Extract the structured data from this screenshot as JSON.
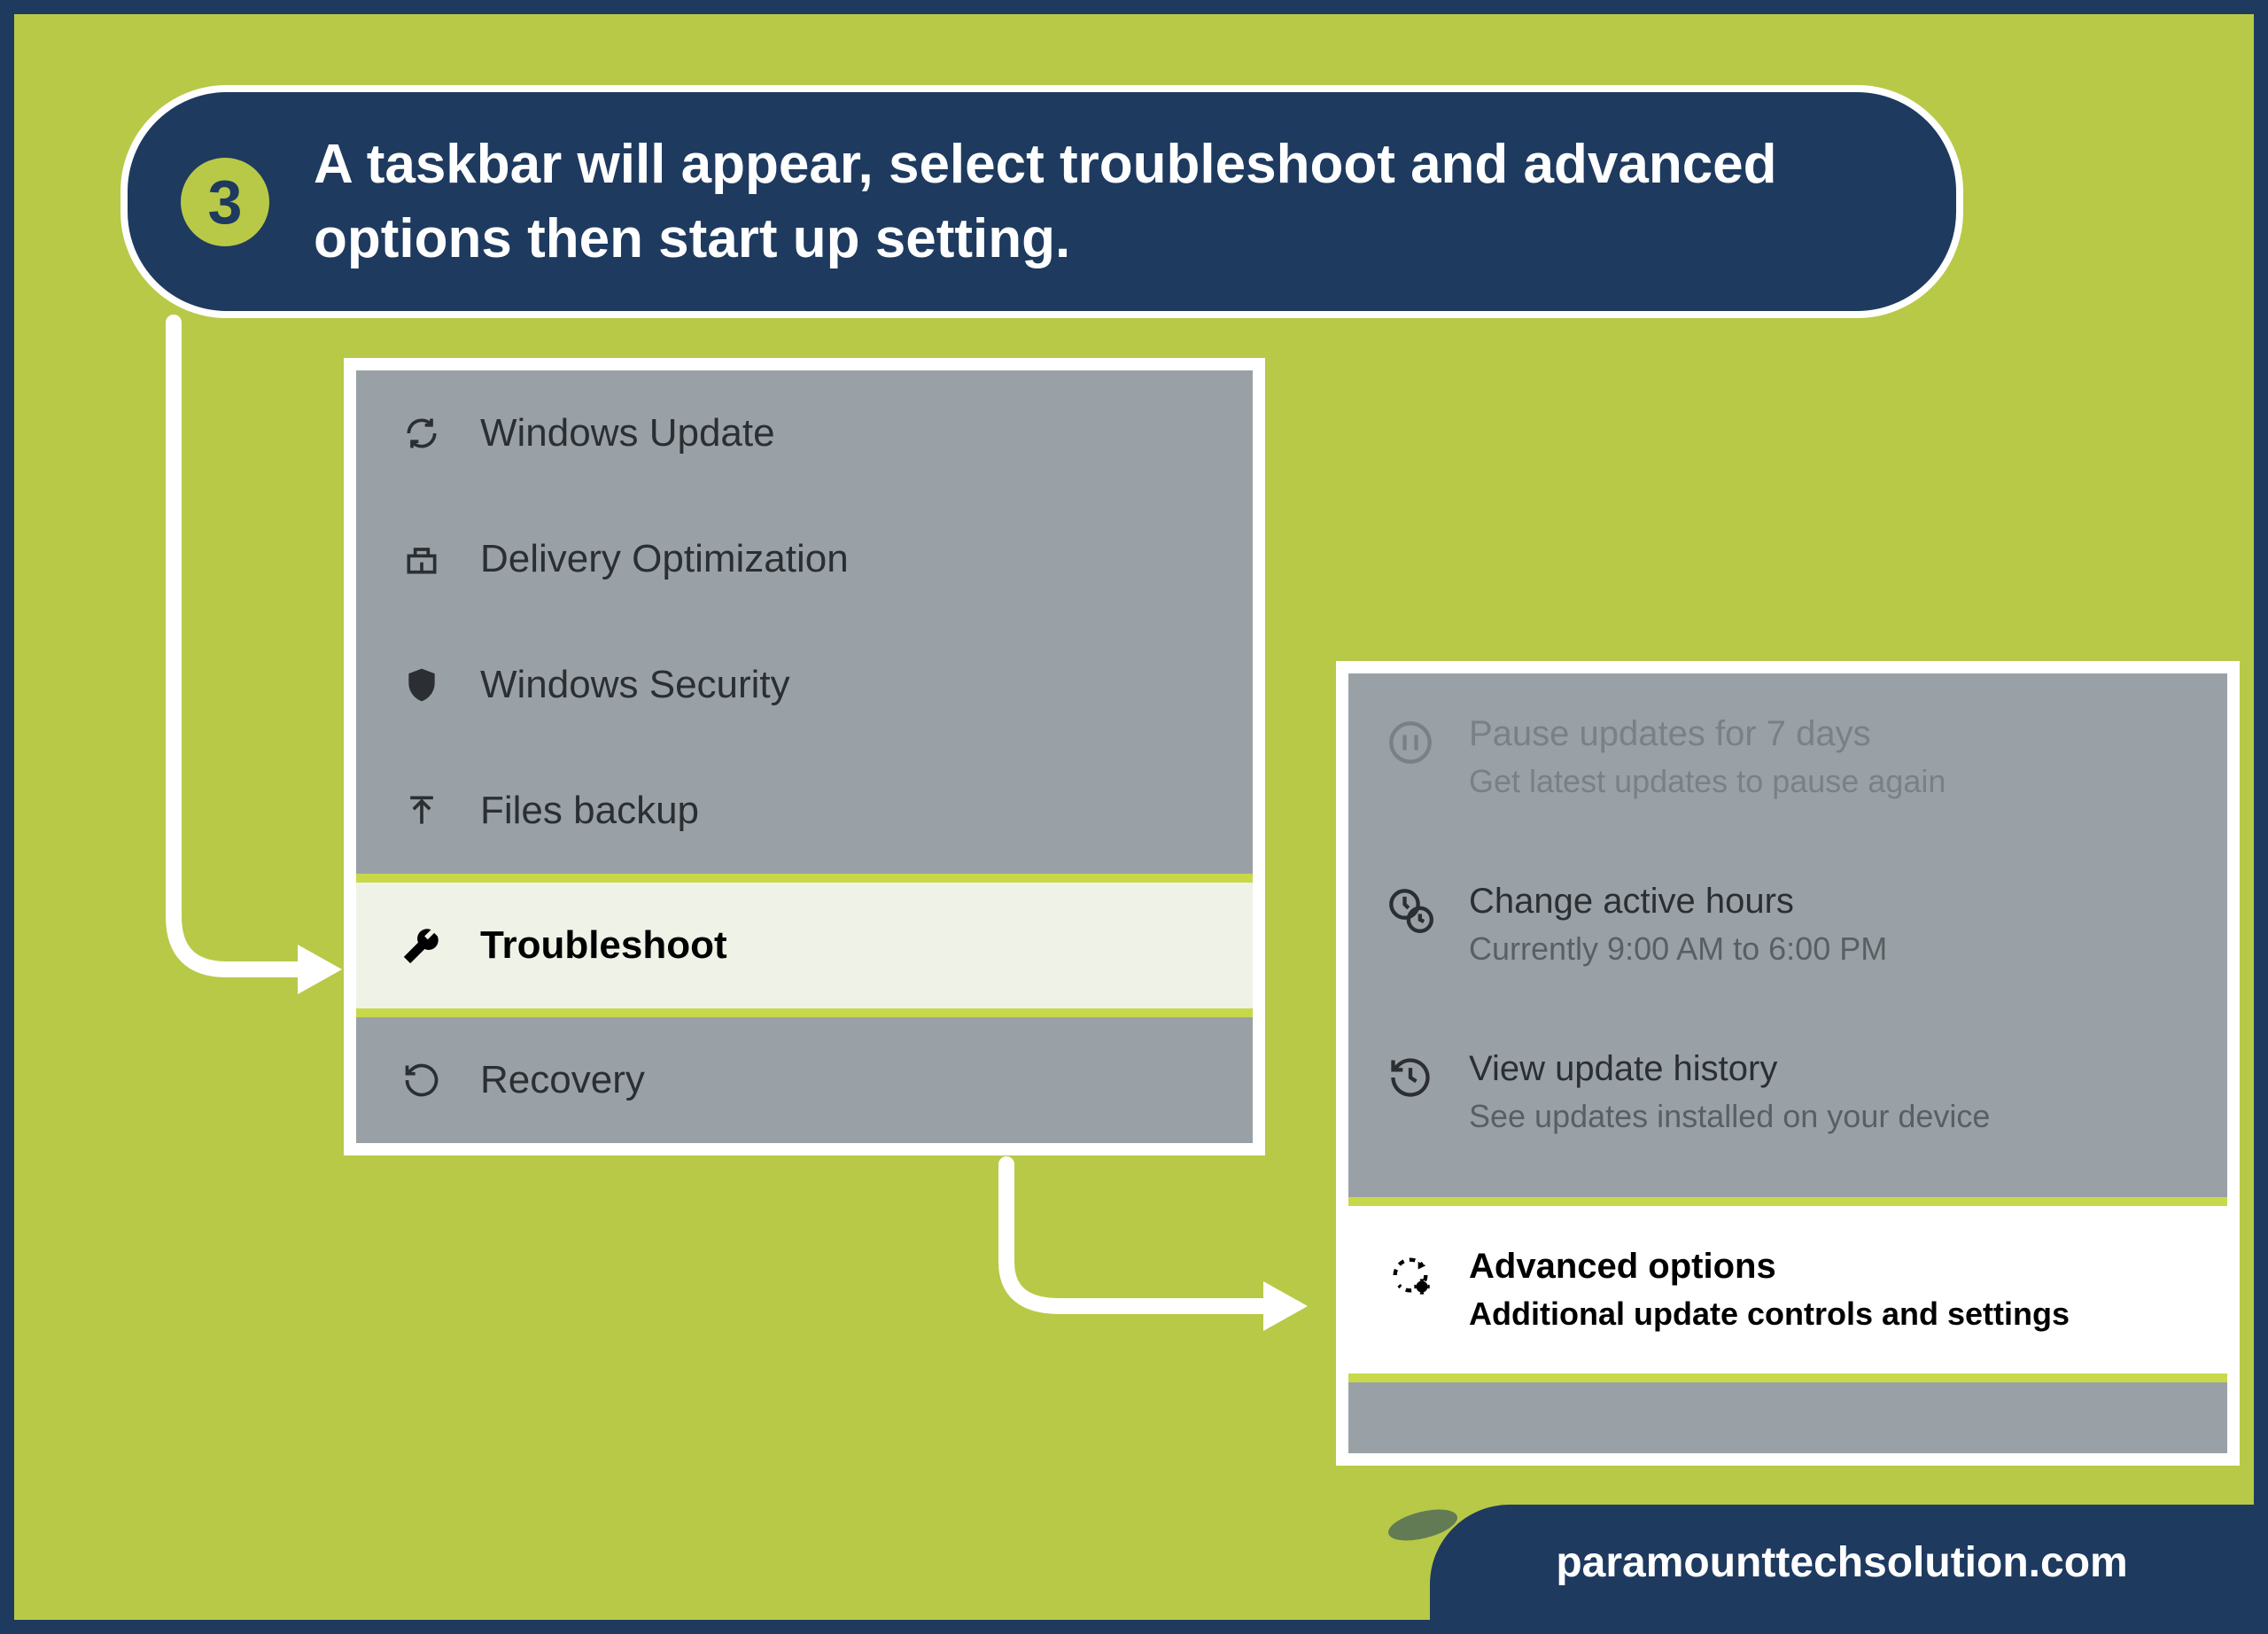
{
  "step": {
    "number": "3",
    "text": "A taskbar will appear, select troubleshoot and advanced options then start up setting."
  },
  "leftPanel": {
    "items": [
      {
        "icon": "refresh-icon",
        "label": "Windows Update",
        "highlighted": false
      },
      {
        "icon": "delivery-icon",
        "label": "Delivery Optimization",
        "highlighted": false
      },
      {
        "icon": "shield-icon",
        "label": "Windows Security",
        "highlighted": false
      },
      {
        "icon": "upload-icon",
        "label": "Files backup",
        "highlighted": false
      },
      {
        "icon": "wrench-icon",
        "label": "Troubleshoot",
        "highlighted": true
      },
      {
        "icon": "recovery-icon",
        "label": "Recovery",
        "highlighted": false
      }
    ]
  },
  "rightPanel": {
    "items": [
      {
        "icon": "pause-icon",
        "title": "Pause updates for 7 days",
        "sub": "Get latest updates to pause again",
        "faded": true
      },
      {
        "icon": "clock-icon",
        "title": "Change active hours",
        "sub": "Currently 9:00 AM to 6:00 PM",
        "faded": false
      },
      {
        "icon": "history-icon",
        "title": "View update history",
        "sub": "See updates installed on your device",
        "faded": false
      },
      {
        "icon": "advanced-icon",
        "title": "Advanced options",
        "sub": "Additional update controls and settings",
        "highlighted": true
      }
    ]
  },
  "footer": {
    "text": "paramounttechsolution.com"
  }
}
